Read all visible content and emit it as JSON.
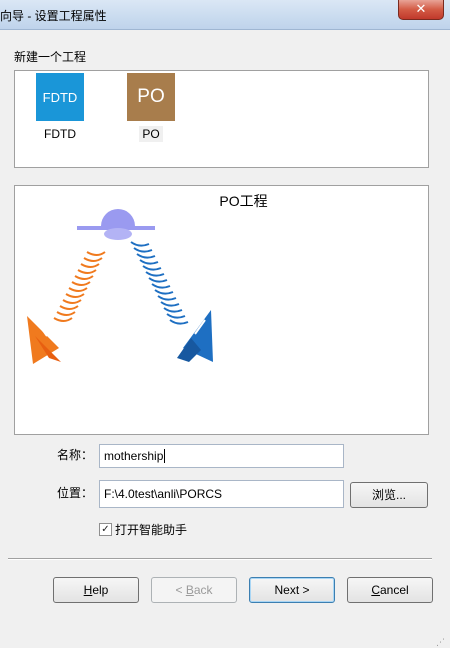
{
  "window": {
    "title": "向导 - 设置工程属性",
    "close_glyph": "✕"
  },
  "new_project": {
    "label": "新建一个工程",
    "items": [
      {
        "icon_text": "FDTD",
        "name": "FDTD",
        "icon_color": "#1a96d8",
        "icon": "fdtd-project-icon"
      },
      {
        "icon_text": "PO",
        "name": "PO",
        "icon_color": "#a87d4c",
        "icon": "po-project-icon"
      }
    ]
  },
  "preview": {
    "title": "PO工程",
    "illustration": "po-radar-scattering-illustration",
    "colors": {
      "orange": "#f07a1e",
      "blue": "#1e6fc2",
      "plate": "#9a9af0"
    }
  },
  "form": {
    "name_label": "名称：",
    "name_value": "mothership",
    "location_label": "位置：",
    "location_value": "F:\\4.0test\\anli\\PORCS",
    "browse_label": "浏览...",
    "open_assistant_label": "打开智能助手",
    "open_assistant_checked": true,
    "check_glyph": "✓"
  },
  "buttons": {
    "help_u": "H",
    "help_rest": "elp",
    "back_prefix": "< ",
    "back_u": "B",
    "back_rest": "ack",
    "next": "Next >",
    "cancel_u": "C",
    "cancel_rest": "ancel"
  }
}
